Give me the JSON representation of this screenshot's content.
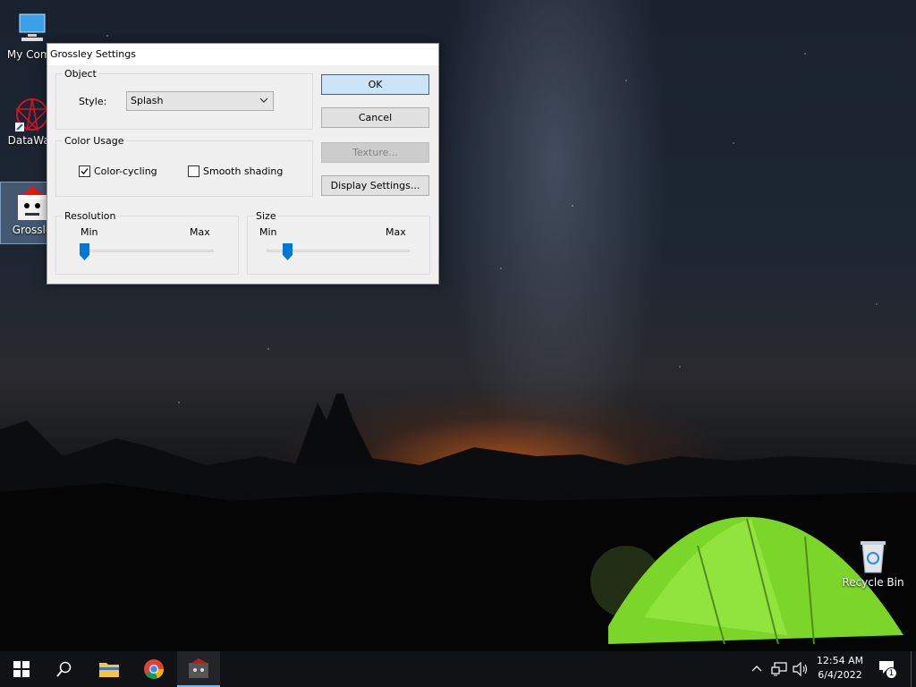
{
  "desktop": {
    "icons": [
      {
        "label": "My Comp"
      },
      {
        "label": "DataWag"
      },
      {
        "label": "Grossle"
      },
      {
        "label": "Recycle Bin"
      }
    ]
  },
  "dialog": {
    "title": "Grossley Settings",
    "object_group": {
      "label": "Object",
      "style_label": "Style:",
      "style_value": "Splash"
    },
    "color_group": {
      "label": "Color Usage",
      "color_cycling": {
        "label": "Color-cycling",
        "checked": true
      },
      "smooth_shading": {
        "label": "Smooth shading",
        "checked": false
      }
    },
    "resolution_group": {
      "label": "Resolution",
      "min_label": "Min",
      "max_label": "Max",
      "value_fraction": 0.0
    },
    "size_group": {
      "label": "Size",
      "min_label": "Min",
      "max_label": "Max",
      "value_fraction": 0.05
    },
    "buttons": {
      "ok": "OK",
      "cancel": "Cancel",
      "texture": "Texture...",
      "display_settings": "Display Settings..."
    }
  },
  "taskbar": {
    "items": [
      "start-icon",
      "search-icon",
      "file-explorer-icon",
      "chrome-icon",
      "grossley-icon"
    ],
    "time": "12:54 AM",
    "date": "6/4/2022",
    "notification_count": "1"
  },
  "colors": {
    "accent": "#0078d7",
    "default_button": "#cce4f7",
    "taskbar": "#101216"
  }
}
